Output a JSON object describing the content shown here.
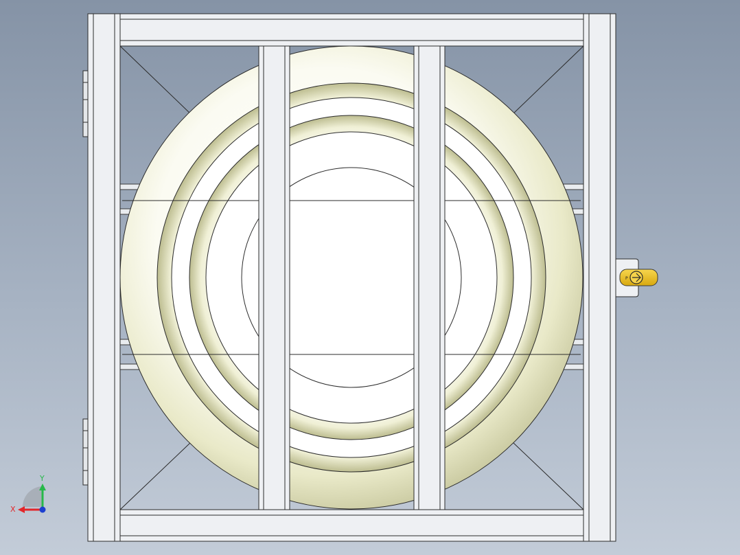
{
  "viewport": {
    "background_top": "#8593a6",
    "background_bottom": "#c3ccd8"
  },
  "model": {
    "frame_color": "#eef0f3",
    "frame_edge_color": "#3a3a3a",
    "tank_shade_color": "#e4e4bf",
    "latch_color": "#f1c21b",
    "latch_text": "P"
  },
  "triad": {
    "x_label": "X",
    "y_label": "Y",
    "x_color": "#e3262a",
    "y_color": "#27b84a",
    "z_color": "#1c3fd0"
  }
}
